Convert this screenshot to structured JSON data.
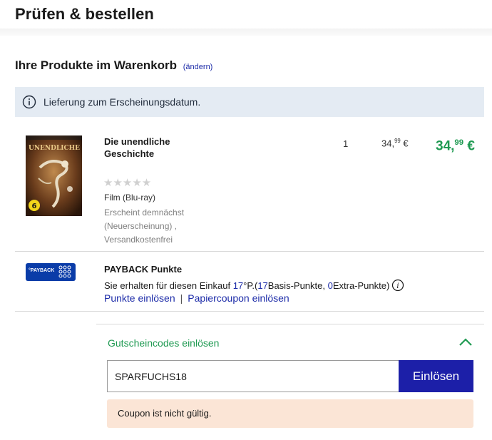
{
  "header": {
    "title": "Prüfen & bestellen"
  },
  "cart": {
    "title": "Ihre Produkte im Warenkorb",
    "change_label": "(ändern)",
    "info_banner": {
      "icon": "info-icon",
      "text": "Lieferung zum Erscheinungsdatum."
    }
  },
  "product": {
    "name": "Die unendliche Geschichte",
    "rating_stars": "★★★★★",
    "rating_value": 0,
    "format": "Film (Blu-ray)",
    "availability": "Erscheint demnächst (Neuerscheinung) , Versandkostenfrei",
    "quantity": "1",
    "unit_price_main": "34,",
    "unit_price_cents": "99",
    "unit_price_currency": " €",
    "total_price_main": "34,",
    "total_price_cents": "99",
    "total_price_currency": " €",
    "cover_icon": "movie-cover",
    "age_rating": "6"
  },
  "payback": {
    "logo_text": "°PAYBACK",
    "title": "PAYBACK Punkte",
    "desc_prefix": "Sie erhalten für diesen Einkauf ",
    "points_total": "17",
    "points_unit": " °P.",
    "desc_mid1": " ( ",
    "basis_points": "17",
    "desc_mid2": " Basis-Punkte, ",
    "extra_points": "0",
    "desc_suffix": " Extra-Punkte)",
    "link_redeem": "Punkte einlösen",
    "separator": "|",
    "link_coupon": "Papiercoupon einlösen"
  },
  "coupon": {
    "title": "Gutscheincodes einlösen",
    "toggle_icon": "chevron-up-icon",
    "input_value": "SPARFUCHS18",
    "button_label": "Einlösen",
    "error": "Coupon ist nicht gültig."
  },
  "colors": {
    "accent_green": "#1f9a52",
    "link_blue": "#1c2ba8",
    "button_blue": "#1c1fa8",
    "info_bg": "#e4ebf3",
    "error_bg": "#fbe5d6"
  }
}
